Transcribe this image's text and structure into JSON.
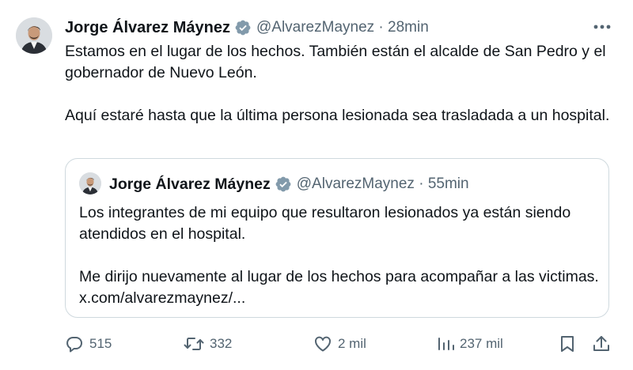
{
  "tweet": {
    "author_name": "Jorge Álvarez Máynez",
    "handle_time": "@AlvarezMaynez · 28min",
    "paragraphs": [
      "Estamos en el lugar de los hechos. También están el alcalde de San Pedro y el gobernador de Nuevo León.",
      "Aquí estaré hasta que la última persona lesionada sea trasladada a un hospital."
    ]
  },
  "quoted": {
    "author_name": "Jorge Álvarez Máynez",
    "handle_time": "@AlvarezMaynez · 55min",
    "paragraphs": [
      "Los integrantes de mi equipo que resultaron lesionados ya están siendo atendidos en el hospital.",
      "Me dirijo nuevamente al lugar de los hechos para acompañar a las victimas. x.com/alvarezmaynez/..."
    ]
  },
  "actions": {
    "replies": "515",
    "reposts": "332",
    "likes": "2 mil",
    "views": "237 mil"
  },
  "icons": {
    "verified": "verified-badge-icon",
    "more": "more-dots-icon",
    "reply": "reply-icon",
    "repost": "repost-icon",
    "like": "heart-icon",
    "views": "views-icon",
    "bookmark": "bookmark-icon",
    "share": "share-icon"
  },
  "colors": {
    "text": "#0f1419",
    "secondary": "#536471",
    "verified": "#829aab",
    "border": "#cfd9de"
  }
}
